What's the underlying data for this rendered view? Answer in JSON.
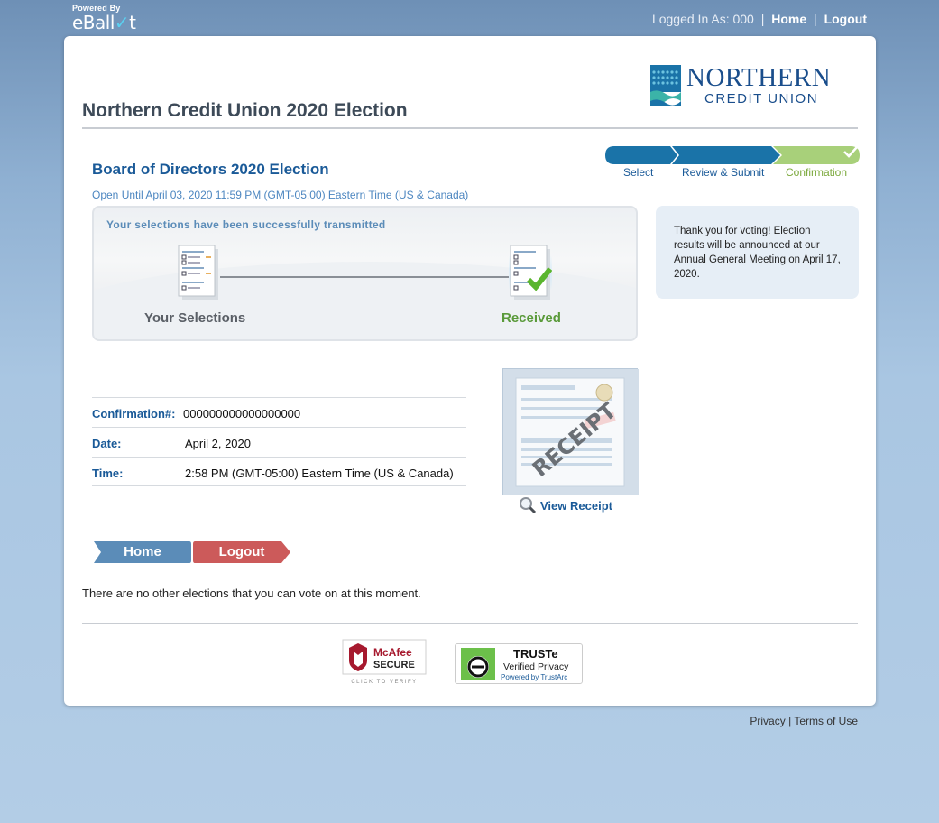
{
  "brand": {
    "powered_by": "Powered By",
    "logo_text": "eBall",
    "logo_tick": "✓",
    "logo_end": "t"
  },
  "topnav": {
    "logged_in": "Logged In As: 000",
    "sep": "|",
    "home": "Home",
    "logout": "Logout"
  },
  "org_logo": {
    "line1": "NORTHERN",
    "line2": "CREDIT UNION"
  },
  "page_title": "Northern Credit Union 2020 Election",
  "steps": [
    {
      "label": "Select",
      "state": "done"
    },
    {
      "label": "Review & Submit",
      "state": "done"
    },
    {
      "label": "Confirmation",
      "state": "current"
    }
  ],
  "election": {
    "title": "Board of Directors 2020 Election",
    "open_until": "Open Until April 03, 2020 11:59 PM (GMT-05:00) Eastern Time (US & Canada)"
  },
  "transmit_panel": {
    "message": "Your selections have been successfully transmitted",
    "left_caption": "Your Selections",
    "right_caption": "Received"
  },
  "thanks_message": "Thank you for voting! Election results will be announced at our Annual General Meeting on April 17, 2020.",
  "confirmation": [
    {
      "label": "Confirmation#:",
      "value": "000000000000000000"
    },
    {
      "label": "Date:",
      "value": "April 2, 2020"
    },
    {
      "label": "Time:",
      "value": "2:58 PM (GMT-05:00) Eastern Time (US & Canada)"
    }
  ],
  "receipt": {
    "stamp_text": "RECEIPT",
    "view_label": "View Receipt"
  },
  "buttons": {
    "home": "Home",
    "logout": "Logout"
  },
  "no_elections": "There are no other elections that you can vote on at this moment.",
  "badges": {
    "mcafee_name": "McAfee",
    "mcafee_secure": "SECURE",
    "mcafee_verify": "CLICK TO VERIFY",
    "truste_name": "TRUSTe",
    "truste_verified": "Verified Privacy",
    "truste_powered": "Powered by TrustArc"
  },
  "footer": {
    "privacy": "Privacy",
    "sep": "|",
    "terms": "Terms of Use"
  },
  "colors": {
    "brand_blue": "#1a5a98",
    "step_blue": "#1a73a8",
    "step_green": "#a8d07a",
    "home_button": "#5b8cb8",
    "logout_button": "#cc5a5a",
    "received_green": "#5a9a3a"
  }
}
